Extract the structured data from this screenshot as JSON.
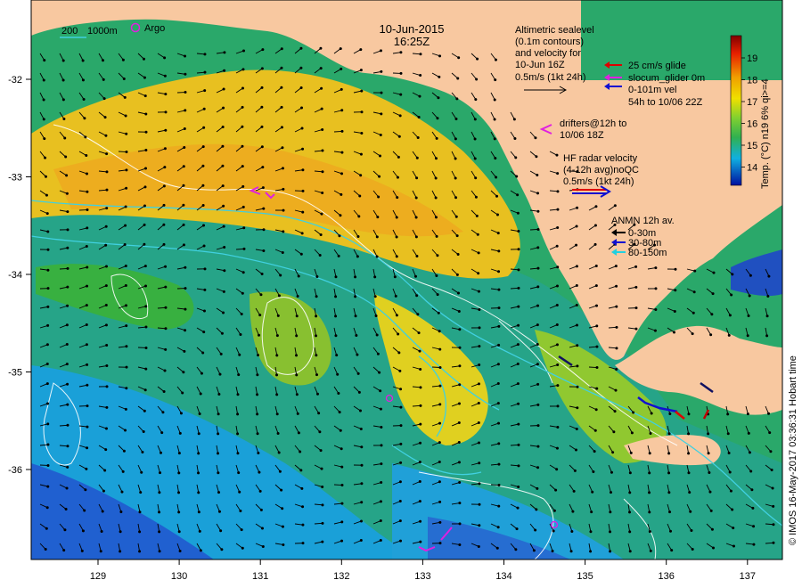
{
  "date": "10-Jun-2015",
  "time": "16:25Z",
  "isobaths": {
    "line1": "200",
    "line2": "1000m"
  },
  "argo": {
    "label": "Argo"
  },
  "altimetry": {
    "line1": "Altimetric sealevel",
    "line2": "(0.1m contours)",
    "line3": "and velocity for",
    "line4": "10-Jun 16Z",
    "line5": "0.5m/s (1kt 24h)"
  },
  "glider": {
    "line1": "25 cm/s glide",
    "line2": "slocum_glider 0m",
    "line3": "0-101m vel",
    "line4": "54h to 10/06 22Z"
  },
  "drifters": {
    "line1": "drifters@12h to",
    "line2": "10/06 18Z"
  },
  "hf_radar": {
    "line1": "HF radar velocity",
    "line2": "(4-12h avg)noQC",
    "line3": "0.5m/s (1kt 24h)"
  },
  "anmn": {
    "title": "ANMN 12h av.",
    "item1": "0-30m",
    "item2": "30-80m",
    "item3": "80-150m"
  },
  "colorbar": {
    "title": "Temp. (°C) n19 6% qi>=4",
    "ticks": [
      "19",
      "18",
      "17",
      "16",
      "15",
      "14"
    ]
  },
  "credit": "© IMOS 16-May-2017 03:36:31 Hobart time",
  "axes": {
    "x_ticks": [
      "129",
      "130",
      "131",
      "132",
      "133",
      "134",
      "135",
      "136",
      "137"
    ],
    "y_ticks": [
      "-32",
      "-33",
      "-34",
      "-35",
      "-36"
    ]
  },
  "colors": {
    "land": "#f8c8a0",
    "sst_warm": "#f0c010",
    "sst_mid": "#40b040",
    "sst_cool": "#20a8d8",
    "sst_cold": "#2050d0"
  }
}
